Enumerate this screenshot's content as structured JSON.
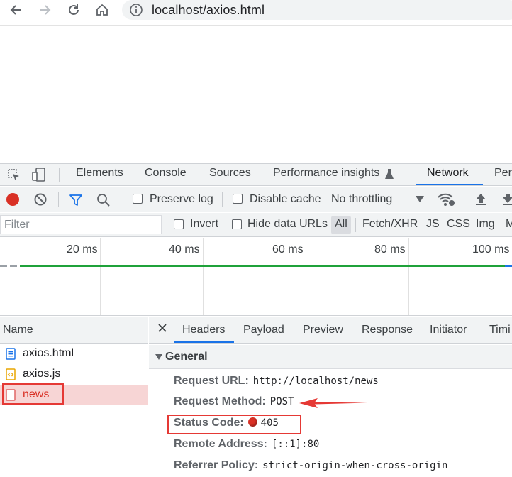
{
  "browser": {
    "url": "localhost/axios.html"
  },
  "devtools": {
    "tabs": [
      "Elements",
      "Console",
      "Sources",
      "Performance insights",
      "Network",
      "Perf"
    ],
    "active_tab": "Network",
    "network_toolbar": {
      "preserve_log": "Preserve log",
      "disable_cache": "Disable cache",
      "throttling": "No throttling"
    },
    "filter": {
      "placeholder": "Filter",
      "invert": "Invert",
      "hide_data_urls": "Hide data URLs",
      "types": [
        "All",
        "Fetch/XHR",
        "JS",
        "CSS",
        "Img",
        "M"
      ]
    },
    "timeline": {
      "ticks": [
        "20 ms",
        "40 ms",
        "60 ms",
        "80 ms",
        "100 ms"
      ]
    },
    "request_list": {
      "header": "Name",
      "rows": [
        {
          "name": "axios.html",
          "icon": "document-icon"
        },
        {
          "name": "axios.js",
          "icon": "script-icon"
        },
        {
          "name": "news",
          "icon": "xhr-icon",
          "selected": true
        }
      ]
    },
    "details": {
      "tabs": [
        "Headers",
        "Payload",
        "Preview",
        "Response",
        "Initiator",
        "Timi"
      ],
      "active_tab": "Headers",
      "section": "General",
      "rows": [
        {
          "key": "Request URL:",
          "value": "http://localhost/news"
        },
        {
          "key": "Request Method:",
          "value": "POST"
        },
        {
          "key": "Status Code:",
          "value": "405"
        },
        {
          "key": "Remote Address:",
          "value": "[::1]:80"
        },
        {
          "key": "Referrer Policy:",
          "value": "strict-origin-when-cross-origin"
        }
      ]
    }
  },
  "colors": {
    "accent": "#1a73e8",
    "status_error": "#d93025",
    "annotation": "#e53935",
    "timeline_bar": "#1fa23a"
  }
}
